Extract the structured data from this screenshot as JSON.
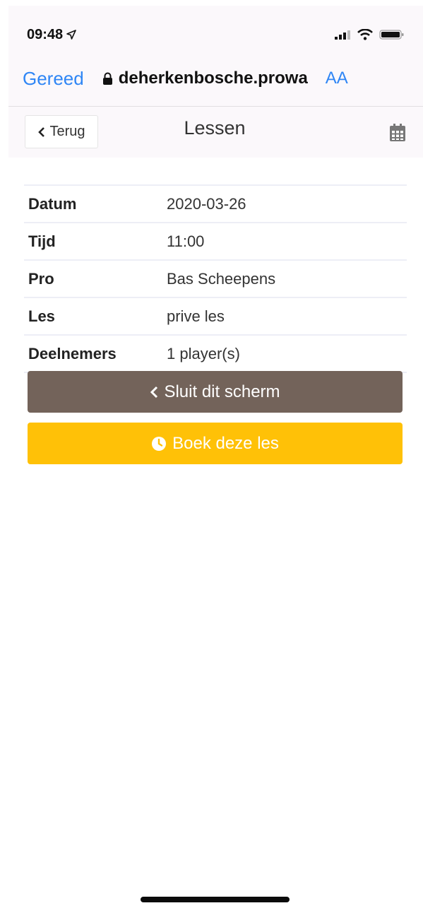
{
  "status_bar": {
    "time": "09:48"
  },
  "browser": {
    "done_label": "Gereed",
    "url": "deherkenbosche.prowa",
    "reader_label": "AA"
  },
  "header": {
    "back_label": "Terug",
    "title": "Lessen"
  },
  "details": [
    {
      "label": "Datum",
      "value": "2020-03-26"
    },
    {
      "label": "Tijd",
      "value": "11:00"
    },
    {
      "label": "Pro",
      "value": "Bas Scheepens"
    },
    {
      "label": "Les",
      "value": "prive les"
    },
    {
      "label": "Deelnemers",
      "value": "1 player(s)"
    }
  ],
  "actions": {
    "close_label": "Sluit dit scherm",
    "book_label": "Boek deze les"
  },
  "colors": {
    "link_blue": "#2f86f5",
    "close_button": "#73635a",
    "book_button": "#ffc107"
  },
  "icons": [
    "location-arrow-icon",
    "signal-icon",
    "wifi-icon",
    "battery-icon",
    "lock-icon",
    "chevron-left-icon",
    "calendar-icon",
    "clock-icon"
  ]
}
